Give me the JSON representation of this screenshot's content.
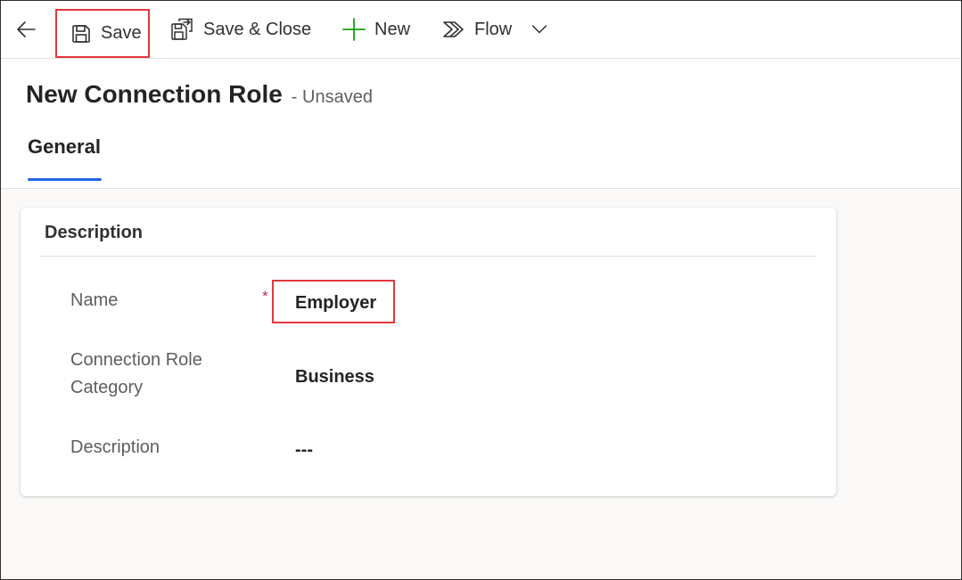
{
  "toolbar": {
    "back_icon": "arrow-left-icon",
    "save_label": "Save",
    "save_icon": "floppy-disk-icon",
    "save_close_label": "Save & Close",
    "save_close_icon": "save-close-icon",
    "new_label": "New",
    "new_icon": "plus-icon",
    "flow_label": "Flow",
    "flow_icon": "flow-icon",
    "flow_menu_icon": "chevron-down-icon"
  },
  "header": {
    "title": "New Connection Role",
    "subtitle": "- Unsaved",
    "tabs": [
      {
        "label": "General",
        "selected": true
      }
    ]
  },
  "form": {
    "section_title": "Description",
    "fields": [
      {
        "label": "Name",
        "value": "Employer",
        "required": true,
        "required_marker": "*"
      },
      {
        "label": "Connection Role Category",
        "value": "Business"
      },
      {
        "label": "Description",
        "value": "---"
      }
    ]
  },
  "colors": {
    "accent": "#2266e3",
    "highlight_border": "#e0393e",
    "required": "#c4314b",
    "new_icon": "#13a10e"
  }
}
